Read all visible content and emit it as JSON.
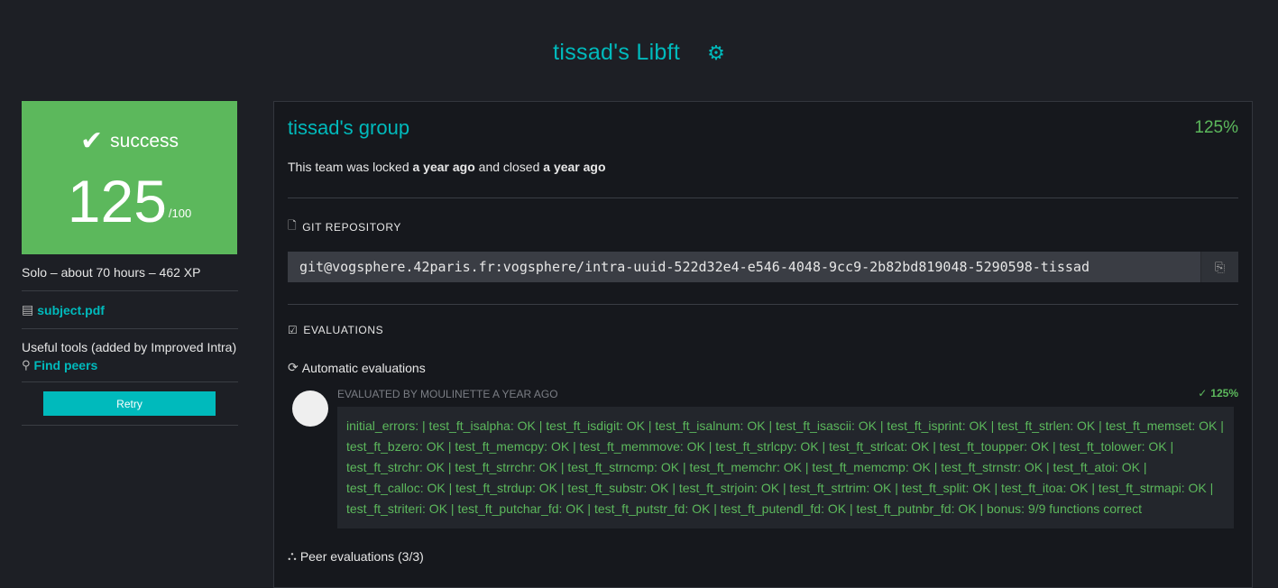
{
  "header": {
    "title": "tissad's Libft",
    "settings_icon": "gear-icon"
  },
  "colors": {
    "accent": "#00babc",
    "success": "#5cb85c",
    "background": "#1d1f25",
    "panel": "#16181d"
  },
  "left": {
    "status_label": "success",
    "score": "125",
    "score_max": "/100",
    "info": "Solo – about 70 hours – 462 XP",
    "subject_link": "subject.pdf",
    "tools_text": "Useful tools (added by Improved Intra)",
    "find_peers": "Find peers",
    "retry_label": "Retry"
  },
  "main": {
    "group_title": "tissad's group",
    "group_percent": "125%",
    "lock_prefix": "This team was locked",
    "lock_time": "a year ago",
    "lock_mid": "and closed",
    "close_time": "a year ago",
    "git_heading": "GIT REPOSITORY",
    "git_url": "git@vogsphere.42paris.fr:vogsphere/intra-uuid-522d32e4-e546-4048-9cc9-2b82bd819048-5290598-tissad",
    "evaluations_heading": "EVALUATIONS",
    "automatic_heading": "Automatic evaluations",
    "eval_meta": "EVALUATED BY MOULINETTE A YEAR AGO",
    "eval_score": "125%",
    "eval_result": "initial_errors:  | test_ft_isalpha: OK | test_ft_isdigit: OK | test_ft_isalnum: OK | test_ft_isascii: OK | test_ft_isprint: OK | test_ft_strlen: OK | test_ft_memset: OK | test_ft_bzero: OK | test_ft_memcpy: OK | test_ft_memmove: OK | test_ft_strlcpy: OK | test_ft_strlcat: OK | test_ft_toupper: OK | test_ft_tolower: OK | test_ft_strchr: OK | test_ft_strrchr: OK | test_ft_strncmp: OK | test_ft_memchr: OK | test_ft_memcmp: OK | test_ft_strnstr: OK | test_ft_atoi: OK | test_ft_calloc: OK | test_ft_strdup: OK | test_ft_substr: OK | test_ft_strjoin: OK | test_ft_strtrim: OK | test_ft_split: OK | test_ft_itoa: OK | test_ft_strmapi: OK | test_ft_striteri: OK | test_ft_putchar_fd: OK | test_ft_putstr_fd: OK | test_ft_putendl_fd: OK | test_ft_putnbr_fd: OK | bonus: 9/9 functions correct",
    "peer_heading": "Peer evaluations (3/3)"
  }
}
